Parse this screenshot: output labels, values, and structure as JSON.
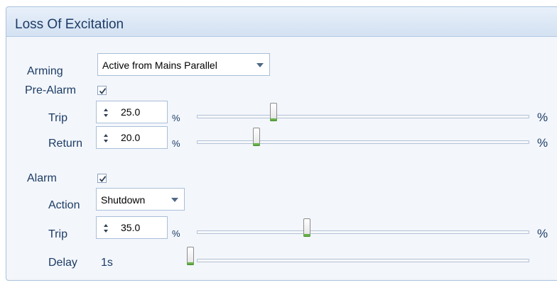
{
  "panel": {
    "title": "Loss Of Excitation"
  },
  "arming": {
    "label": "Arming",
    "selected": "Active from Mains Parallel"
  },
  "pre_alarm": {
    "label": "Pre-Alarm",
    "enabled": true,
    "trip": {
      "label": "Trip",
      "value": "25.0",
      "unit": "%",
      "unit_right": "%",
      "level": 25.0
    },
    "return": {
      "label": "Return",
      "value": "20.0",
      "unit": "%",
      "unit_right": "%",
      "level": 20.0
    }
  },
  "alarm": {
    "label": "Alarm",
    "enabled": true,
    "action": {
      "label": "Action",
      "selected": "Shutdown"
    },
    "trip": {
      "label": "Trip",
      "value": "35.0",
      "unit": "%",
      "unit_right": "%",
      "level": 35.0
    },
    "delay": {
      "label": "Delay",
      "value": "1s",
      "level": 1
    }
  },
  "colors": {
    "title_text": "#1c3c66",
    "header_bg": "#d9e5f4",
    "panel_bg": "#f3f6fb",
    "thumb_accent": "#6ab04c"
  }
}
